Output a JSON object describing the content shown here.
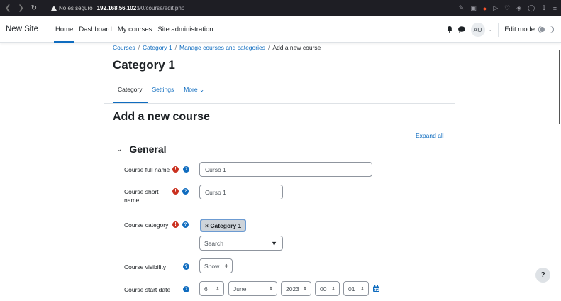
{
  "browser": {
    "security_label": "No es seguro",
    "url_host": "192.168.56.102",
    "url_path": ":90/course/edit.php"
  },
  "navbar": {
    "brand": "New Site",
    "items": [
      {
        "label": "Home",
        "active": true
      },
      {
        "label": "Dashboard"
      },
      {
        "label": "My courses"
      },
      {
        "label": "Site administration"
      }
    ],
    "avatar_initials": "AU",
    "edit_mode_label": "Edit mode"
  },
  "breadcrumb": {
    "items": [
      "Courses",
      "Category 1",
      "Manage courses and categories"
    ],
    "current": "Add a new course",
    "separator": "/"
  },
  "page": {
    "title": "Category 1",
    "tabs": [
      {
        "label": "Category",
        "active": true
      },
      {
        "label": "Settings"
      },
      {
        "label": "More ⌄"
      }
    ],
    "heading": "Add a new course",
    "expand_all": "Expand all"
  },
  "general": {
    "section_title": "General",
    "full_name": {
      "label": "Course full name",
      "value": "Curso 1"
    },
    "short_name": {
      "label_line1": "Course short",
      "label_line2": "name",
      "value": "Curso 1"
    },
    "category": {
      "label": "Course category",
      "chip": "× Category 1",
      "search_placeholder": "Search"
    },
    "visibility": {
      "label": "Course visibility",
      "value": "Show"
    },
    "start_date": {
      "label": "Course start date",
      "day": "6",
      "month": "June",
      "year": "2023",
      "hour": "00",
      "minute": "01"
    }
  },
  "help_fab": "?",
  "colors": {
    "brand_blue": "#0f6cbf",
    "required_red": "#ca3120",
    "browser_bg": "#1e1e24"
  }
}
